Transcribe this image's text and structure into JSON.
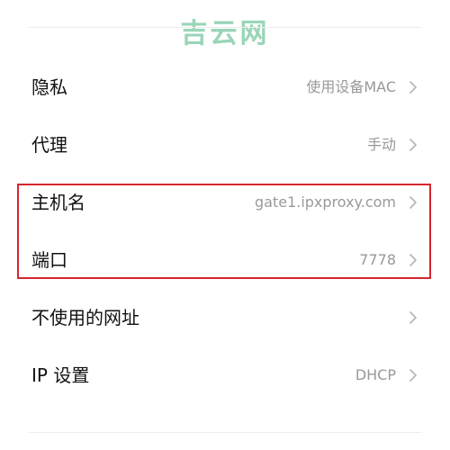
{
  "watermark": "吉云网",
  "rows": [
    {
      "label": "隐私",
      "value": "使用设备MAC"
    },
    {
      "label": "代理",
      "value": "手动"
    },
    {
      "label": "主机名",
      "value": "gate1.ipxproxy.com"
    },
    {
      "label": "端口",
      "value": "7778"
    },
    {
      "label": "不使用的网址",
      "value": ""
    },
    {
      "label": "IP 设置",
      "value": "DHCP"
    }
  ],
  "icons": {
    "chevron": "chevron-right-icon"
  },
  "colors": {
    "highlight": "#d6262c",
    "watermark": "#8fd1b0",
    "value_text": "#999999"
  }
}
